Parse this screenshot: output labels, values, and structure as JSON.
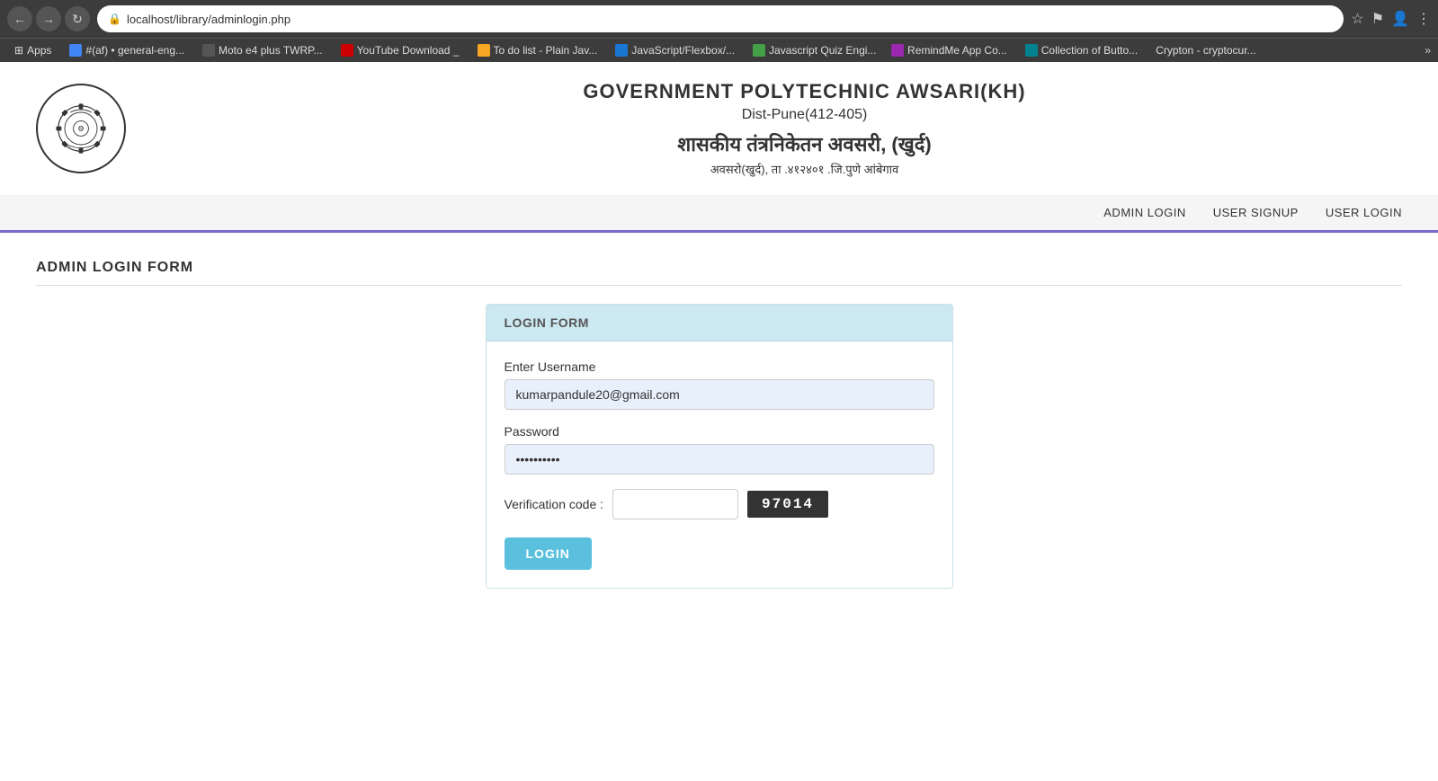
{
  "browser": {
    "url": "localhost/library/adminlogin.php",
    "nav_back": "◀",
    "nav_forward": "▶",
    "nav_refresh": "↻",
    "lock_icon": "🔒",
    "bookmarks": [
      {
        "label": "Apps",
        "color": "#4285f4",
        "icon": "⊞"
      },
      {
        "label": "#(af) • general-eng...",
        "color": "#555"
      },
      {
        "label": "Moto e4 plus TWRP...",
        "color": "#555"
      },
      {
        "label": "YouTube Download _",
        "color": "#cc0000"
      },
      {
        "label": "To do list - Plain Jav...",
        "color": "#555"
      },
      {
        "label": "JavaScript/Flexbox/...",
        "color": "#555"
      },
      {
        "label": "Javascript Quiz Engi...",
        "color": "#555"
      },
      {
        "label": "RemindMe App Co...",
        "color": "#555"
      },
      {
        "label": "Collection of Butto...",
        "color": "#555"
      },
      {
        "label": "Crypton - cryptocur...",
        "color": "#555"
      }
    ],
    "more": "»"
  },
  "header": {
    "institute_name_en": "GOVERNMENT POLYTECHNIC AWSARI(KH)",
    "dist_info": "Dist-Pune(412-405)",
    "institute_name_hi": "शासकीय तंत्रनिकेतन अवसरी, (खुर्द)",
    "address_hi": "अवसरो(खुर्द), ता .४१२४०१ .जि.पुणे आंबेगाव"
  },
  "nav": {
    "admin_login": "ADMIN LOGIN",
    "user_signup": "USER SIGNUP",
    "user_login": "USER LOGIN"
  },
  "form": {
    "title": "ADMIN LOGIN FORM",
    "card_header": "LOGIN FORM",
    "username_label": "Enter Username",
    "username_value": "kumarpandule20@gmail.com",
    "password_label": "Password",
    "password_value": "••••••••••",
    "verification_label": "Verification code :",
    "verification_value": "",
    "captcha_value": "97014",
    "login_button": "LOGIN"
  }
}
